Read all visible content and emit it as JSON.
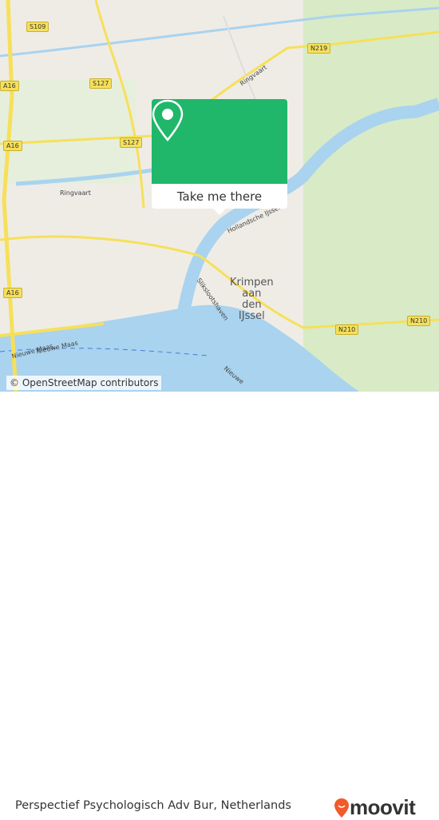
{
  "map": {
    "road_shields": [
      "S109",
      "A16",
      "S127",
      "S127",
      "A16",
      "A16",
      "N219",
      "N210",
      "N210"
    ],
    "labels": {
      "ringvaart_1": "Ringvaart",
      "ringvaart_2": "Ringvaart",
      "hollandsche": "Hollandsche IJssel",
      "slikslooth": "Slikslootshaven",
      "nieuwe_maas_1": "Nieuwe Maas",
      "nieuwe_maas_2": "Nieuwe Maas",
      "nieuwe_3": "Nieuwe"
    },
    "town": [
      "Krimpen",
      "aan",
      "den",
      "IJssel"
    ],
    "colors": {
      "water": "#a9d3ef",
      "land": "#efece6",
      "green": "#cfe6b8",
      "road": "#f6e05a"
    }
  },
  "popup": {
    "button_label": "Take me there",
    "icon": "map-pin-icon",
    "color": "#20b76b"
  },
  "attribution": "© OpenStreetMap contributors",
  "footer": {
    "place": "Perspectief Psychologisch Adv Bur, Netherlands",
    "logo": "moovit",
    "logo_color": "#f25a2a"
  }
}
